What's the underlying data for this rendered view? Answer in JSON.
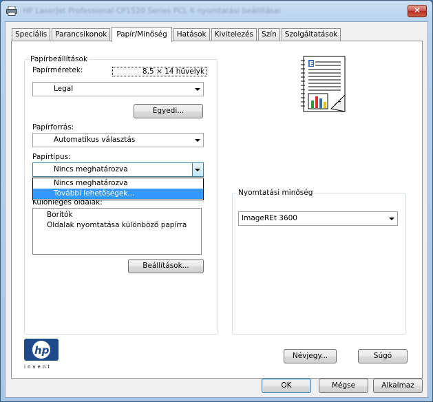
{
  "window": {
    "title": "HP LaserJet Professional CP1520 Series PCL 6 nyomtatási beállításai",
    "close_label": "✕"
  },
  "tabs": [
    {
      "label": "Speciális"
    },
    {
      "label": "Parancsikonok"
    },
    {
      "label": "Papír/Minőség"
    },
    {
      "label": "Hatások"
    },
    {
      "label": "Kivitelezés"
    },
    {
      "label": "Szín"
    },
    {
      "label": "Szolgáltatások"
    }
  ],
  "paper_settings": {
    "group_title": "Papírbeállítások",
    "size_label": "Papírméretek:",
    "size_value": "8,5 × 14 hüvelyk",
    "size_selected": "Legal",
    "custom_button": "Egyedi...",
    "source_label": "Papírforrás:",
    "source_selected": "Automatikus választás",
    "type_label": "Papírtípus:",
    "type_selected": "Nincs meghatározva",
    "type_options": [
      "Nincs meghatározva",
      "További lehetőségek..."
    ],
    "special_pages_label": "Különleges oldalak:",
    "special_pages": [
      "Borítók",
      "Oldalak nyomtatása különböző papírra"
    ],
    "settings_button": "Beállítások..."
  },
  "print_quality": {
    "group_title": "Nyomtatási minőség",
    "selected": "ImageREt 3600"
  },
  "logo": {
    "text": "invent"
  },
  "footer": {
    "about_button": "Névjegy...",
    "help_button": "Súgó",
    "ok_button": "OK",
    "cancel_button": "Mégse",
    "apply_button": "Alkalmaz"
  }
}
